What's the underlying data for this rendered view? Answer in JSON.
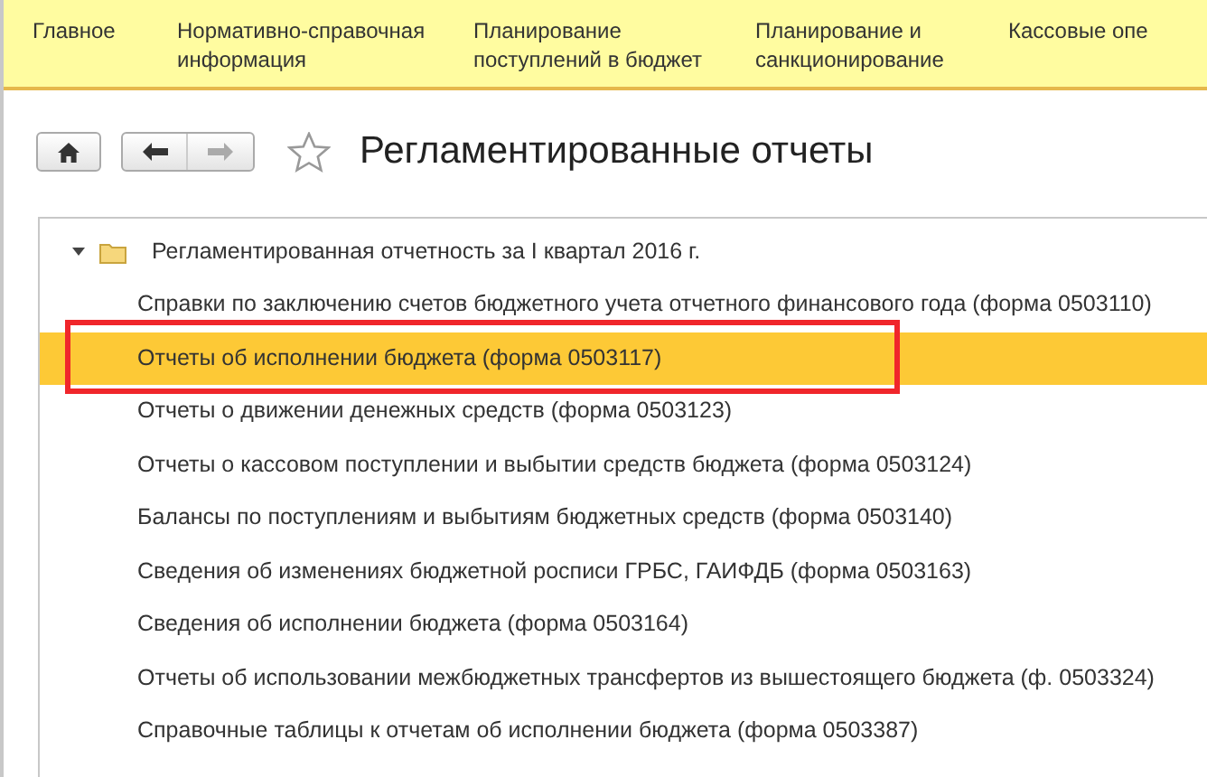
{
  "menu": [
    {
      "label": "Главное"
    },
    {
      "label": "Нормативно-справочная информация"
    },
    {
      "label": "Планирование поступлений в бюджет"
    },
    {
      "label": "Планирование и санкционирование"
    },
    {
      "label": "Кассовые опе"
    }
  ],
  "title": "Регламентированные отчеты",
  "favorite": false,
  "forward_disabled": true,
  "tree": {
    "label": "Регламентированная отчетность за I квартал 2016 г.",
    "expanded": true,
    "children": [
      {
        "label": "Справки по заключению счетов бюджетного учета отчетного финансового года (форма 0503110)",
        "selected": false
      },
      {
        "label": "Отчеты об исполнении бюджета (форма 0503117)",
        "selected": true
      },
      {
        "label": "Отчеты о движении денежных средств (форма 0503123)",
        "selected": false
      },
      {
        "label": "Отчеты о кассовом поступлении и выбытии средств бюджета (форма 0503124)",
        "selected": false
      },
      {
        "label": "Балансы по поступлениям и выбытиям бюджетных средств (форма 0503140)",
        "selected": false
      },
      {
        "label": "Сведения об изменениях бюджетной росписи ГРБС, ГАИФДБ (форма 0503163)",
        "selected": false
      },
      {
        "label": "Сведения об исполнении бюджета (форма 0503164)",
        "selected": false
      },
      {
        "label": "Отчеты об использовании межбюджетных трансфертов из вышестоящего бюджета (ф. 0503324)",
        "selected": false
      },
      {
        "label": "Справочные таблицы к отчетам об исполнении бюджета (форма 0503387)",
        "selected": false
      }
    ]
  }
}
